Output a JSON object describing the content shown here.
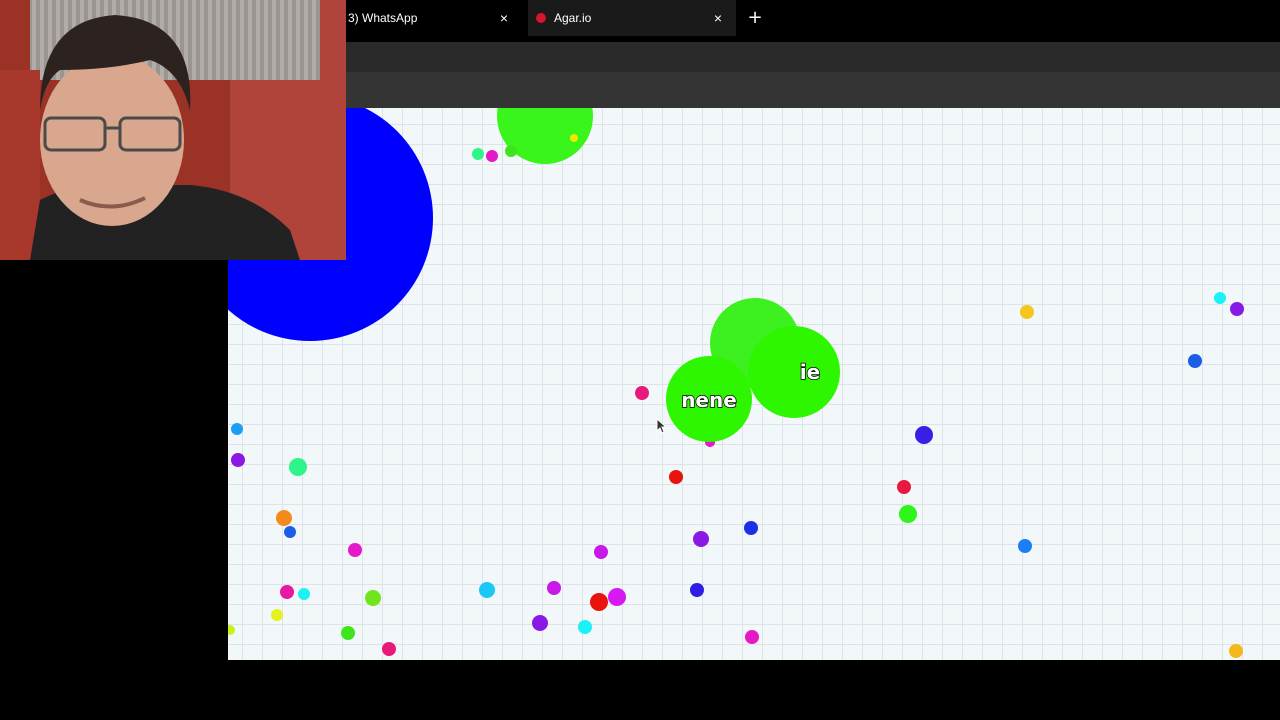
{
  "tabs": [
    {
      "label": "3) WhatsApp",
      "close": "×"
    },
    {
      "label": "Agar.io",
      "close": "×",
      "active": true
    }
  ],
  "new_tab_symbol": "+",
  "player": {
    "name": "nene",
    "partial_name": "ie",
    "color": "#2ef500"
  },
  "colors": {
    "background": "#f2f7f9",
    "grid": "#dde3e7",
    "enemy_cell": "#0000ff",
    "player_cell": "#2ef500"
  }
}
